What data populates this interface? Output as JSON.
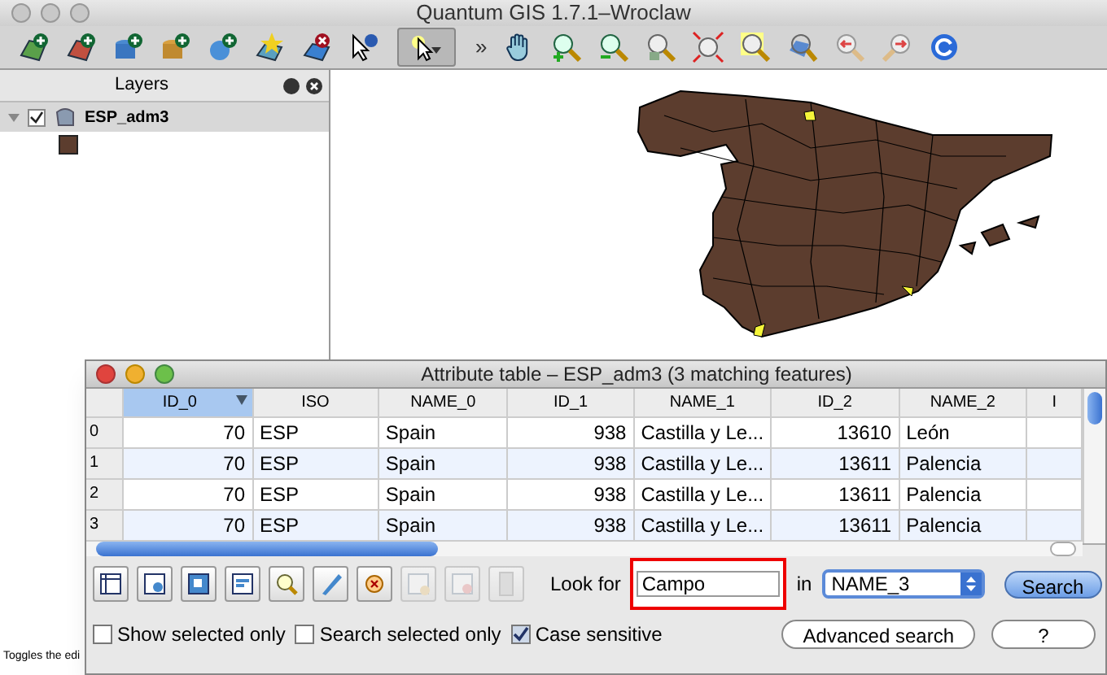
{
  "window": {
    "title": "Quantum GIS 1.7.1–Wroclaw"
  },
  "toolbar": {
    "tools": [
      {
        "kind": "add-vector",
        "selected": false
      },
      {
        "kind": "add-raster",
        "selected": false
      },
      {
        "kind": "add-db",
        "selected": false
      },
      {
        "kind": "add-db-gold",
        "selected": false
      },
      {
        "kind": "add-globe",
        "selected": false
      },
      {
        "kind": "new-layer",
        "selected": false
      },
      {
        "kind": "remove-layer",
        "selected": false
      },
      {
        "kind": "identify",
        "selected": false
      },
      {
        "kind": "select",
        "selected": true
      },
      {
        "kind": "overflow",
        "text": "»",
        "selected": false
      },
      {
        "kind": "pan",
        "selected": false
      },
      {
        "kind": "zoom-in",
        "selected": false
      },
      {
        "kind": "zoom-out",
        "selected": false
      },
      {
        "kind": "zoom-full",
        "selected": false
      },
      {
        "kind": "zoom-extent",
        "selected": false
      },
      {
        "kind": "zoom-selection",
        "selected": false
      },
      {
        "kind": "zoom-layer",
        "selected": false
      },
      {
        "kind": "zoom-last",
        "selected": false
      },
      {
        "kind": "zoom-next",
        "selected": false
      },
      {
        "kind": "refresh",
        "selected": false
      }
    ]
  },
  "layers_panel": {
    "title": "Layers",
    "layers": [
      {
        "name": "ESP_adm3",
        "checked": true,
        "expanded": true,
        "color": "#5c3d2e"
      }
    ]
  },
  "status_bar": {
    "text": "Toggles the edi"
  },
  "attribute_table": {
    "title": "Attribute table – ESP_adm3 (3 matching features)",
    "columns": [
      {
        "label": "ID_0",
        "selected": true,
        "kind": "number"
      },
      {
        "label": "ISO",
        "selected": false,
        "kind": "text"
      },
      {
        "label": "NAME_0",
        "selected": false,
        "kind": "text"
      },
      {
        "label": "ID_1",
        "selected": false,
        "kind": "number"
      },
      {
        "label": "NAME_1",
        "selected": false,
        "kind": "text"
      },
      {
        "label": "ID_2",
        "selected": false,
        "kind": "number"
      },
      {
        "label": "NAME_2",
        "selected": false,
        "kind": "text"
      },
      {
        "label": "I",
        "selected": false,
        "kind": "text"
      }
    ],
    "rows": [
      {
        "index": "0",
        "cells": [
          "70",
          "ESP",
          "Spain",
          "938",
          "Castilla y Le...",
          "13610",
          "León",
          ""
        ]
      },
      {
        "index": "1",
        "cells": [
          "70",
          "ESP",
          "Spain",
          "938",
          "Castilla y Le...",
          "13611",
          "Palencia",
          ""
        ]
      },
      {
        "index": "2",
        "cells": [
          "70",
          "ESP",
          "Spain",
          "938",
          "Castilla y Le...",
          "13611",
          "Palencia",
          ""
        ]
      },
      {
        "index": "3",
        "cells": [
          "70",
          "ESP",
          "Spain",
          "938",
          "Castilla y Le...",
          "13611",
          "Palencia",
          ""
        ]
      }
    ],
    "tools": [
      {
        "kind": "table",
        "disabled": false
      },
      {
        "kind": "table-select",
        "disabled": false
      },
      {
        "kind": "table-invert",
        "disabled": false
      },
      {
        "kind": "table-top",
        "disabled": false
      },
      {
        "kind": "zoom",
        "disabled": false
      },
      {
        "kind": "edit",
        "disabled": false
      },
      {
        "kind": "delete",
        "disabled": false
      },
      {
        "kind": "copy",
        "disabled": true
      },
      {
        "kind": "remove",
        "disabled": true
      },
      {
        "kind": "calculator",
        "disabled": true
      }
    ],
    "look_for_label": "Look for",
    "look_for": {
      "value": "Campo"
    },
    "in_label": "in",
    "field_select": {
      "value": "NAME_3"
    },
    "search_button": "Search",
    "options": [
      {
        "label": "Show selected only",
        "checked": false
      },
      {
        "label": "Search selected only",
        "checked": false
      },
      {
        "label": "Case sensitive",
        "checked": true
      }
    ],
    "advanced_button": "Advanced search",
    "help_button": "?"
  }
}
